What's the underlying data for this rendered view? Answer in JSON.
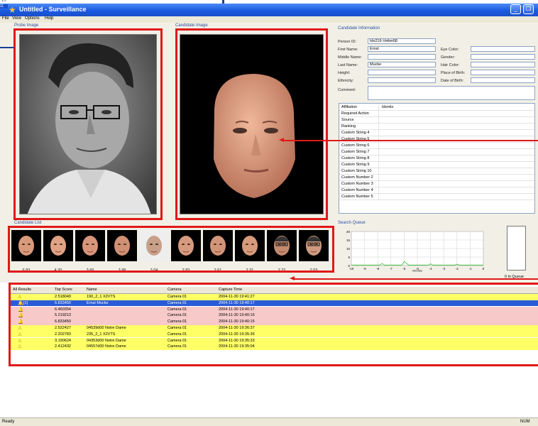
{
  "top_strip": {
    "left_text": "15",
    "small_text_1": "",
    "side_text": "11"
  },
  "window": {
    "title": "Untitled - Surveillance"
  },
  "menu": [
    "File",
    "View",
    "Options",
    "Help"
  ],
  "panels": {
    "probe_image_title": "Probe Image",
    "candidate_image_title": "Candidate Image",
    "candidate_info_title": "Candidate Information",
    "candidate_list_title": "Candidate List",
    "search_queue_title": "Search Queue"
  },
  "candidate_info": {
    "fields_left": [
      {
        "label": "Person ID:",
        "value": "Idx216-Vetter68"
      },
      {
        "label": "First Name:",
        "value": "Ernst"
      },
      {
        "label": "Middle Name:",
        "value": ""
      },
      {
        "label": "Last Name:",
        "value": "Mucke"
      },
      {
        "label": "Height:",
        "value": ""
      },
      {
        "label": "Ethnicity:",
        "value": ""
      },
      {
        "label": "Comment:",
        "value": ""
      }
    ],
    "fields_right": [
      {
        "label": "Eye Color:",
        "value": ""
      },
      {
        "label": "Gender:",
        "value": ""
      },
      {
        "label": "Hair Color:",
        "value": ""
      },
      {
        "label": "Place of Birth:",
        "value": ""
      },
      {
        "label": "Date of Birth:",
        "value": ""
      }
    ],
    "attributes": [
      {
        "key": "Affiliation",
        "value": "Identix"
      },
      {
        "key": "Required Action",
        "value": ""
      },
      {
        "key": "Source",
        "value": ""
      },
      {
        "key": "Ranking",
        "value": ""
      },
      {
        "key": "Custom String 4",
        "value": ""
      },
      {
        "key": "Custom String 5",
        "value": ""
      },
      {
        "key": "Custom String 6",
        "value": ""
      },
      {
        "key": "Custom String 7",
        "value": ""
      },
      {
        "key": "Custom String 8",
        "value": ""
      },
      {
        "key": "Custom String 9",
        "value": ""
      },
      {
        "key": "Custom String 10",
        "value": ""
      },
      {
        "key": "Custom Number 2",
        "value": ""
      },
      {
        "key": "Custom Number 3",
        "value": ""
      },
      {
        "key": "Custom Number 4",
        "value": ""
      },
      {
        "key": "Custom Number 5",
        "value": ""
      }
    ]
  },
  "candidate_list": {
    "scores": [
      "6.83",
      "4.20",
      "3.69",
      "3.98",
      "3.04",
      "2.83",
      "2.61",
      "2.31",
      "2.22",
      "2.03"
    ]
  },
  "search_queue": {
    "y_ticks": [
      "20",
      "15",
      "10",
      "5",
      "0"
    ],
    "x_ticks": [
      "-10",
      "-9",
      "-8",
      "-7",
      "-6",
      "-5",
      "-4",
      "-3",
      "-2",
      "-1",
      "0"
    ],
    "x_label": "minutes",
    "queue_label": "0 in Queue"
  },
  "results": {
    "headers": [
      "All Results",
      "Top Score",
      "Name",
      "Camera",
      "Capture Time"
    ],
    "rows": [
      {
        "icon": "warn",
        "id": "",
        "score": "2.518049",
        "name": "190_2_1 X2VTS",
        "camera": "Camera 01",
        "time": "2004-11-30 19:41:27",
        "style": "yellow"
      },
      {
        "icon": "bell",
        "id": "[1]",
        "score": "6.833450",
        "name": "Ernst Mucke",
        "camera": "Camera 01",
        "time": "2004-11-30 19:40:17",
        "style": "selected"
      },
      {
        "icon": "bell",
        "id": "",
        "score": "6.460354",
        "name": "",
        "camera": "Camera 01",
        "time": "2004-11-30 19:40:17",
        "style": "pink"
      },
      {
        "icon": "bell",
        "id": "",
        "score": "5.219213",
        "name": "",
        "camera": "Camera 01",
        "time": "2004-11-30 19:40:16",
        "style": "pink"
      },
      {
        "icon": "bell",
        "id": "",
        "score": "6.833450",
        "name": "",
        "camera": "Camera 01",
        "time": "2004-11-30 19:40:15",
        "style": "pink"
      },
      {
        "icon": "warn",
        "id": "",
        "score": "2.522427",
        "name": "04539d00 Notre Dame",
        "camera": "Camera 01",
        "time": "2004-11-30 19:36:37",
        "style": "yellow"
      },
      {
        "icon": "warn",
        "id": "",
        "score": "2.202783",
        "name": "235_2_1 X2VTS",
        "camera": "Camera 01",
        "time": "2004-11-30 19:35:36",
        "style": "yellow"
      },
      {
        "icon": "warn",
        "id": "",
        "score": "3.190624",
        "name": "04353d00 Notre Dame",
        "camera": "Camera 01",
        "time": "2004-11-30 19:35:33",
        "style": "yellow"
      },
      {
        "icon": "warn",
        "id": "",
        "score": "2.412432",
        "name": "04557d00 Notre Dame",
        "camera": "Camera 01",
        "time": "2004-11-30 19:35:04",
        "style": "yellow"
      }
    ]
  },
  "status": {
    "left": "Ready",
    "right": "NUM"
  },
  "colors": {
    "annotation_red": "#e01818",
    "row_yellow": "#ffff66",
    "row_pink": "#f7c9c9",
    "row_selected": "#2a5bd7",
    "chart_line": "#3bbf3b"
  }
}
